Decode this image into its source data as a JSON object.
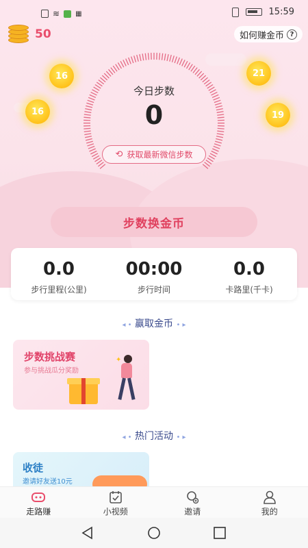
{
  "status_bar": {
    "time": "15:59"
  },
  "header": {
    "coin_count": "50",
    "how_to_earn": "如何赚金币"
  },
  "bubbles": [
    "16",
    "21",
    "16",
    "19"
  ],
  "steps": {
    "title": "今日步数",
    "value": "0",
    "refresh_label": "获取最新微信步数"
  },
  "exchange_button": "步数换金币",
  "stats": [
    {
      "value": "0.0",
      "label": "步行里程(公里)"
    },
    {
      "value": "00:00",
      "label": "步行时间"
    },
    {
      "value": "0.0",
      "label": "卡路里(千卡)"
    }
  ],
  "sections": {
    "earn": "赢取金币",
    "hot": "热门活动"
  },
  "challenge": {
    "title": "步数挑战赛",
    "subtitle": "参与挑战瓜分奖励"
  },
  "recruit": {
    "title": "收徒",
    "subtitle": "邀请好友送10元"
  },
  "nav": [
    {
      "label": "走路赚",
      "icon": "gamepad-icon"
    },
    {
      "label": "小视频",
      "icon": "calendar-video-icon"
    },
    {
      "label": "邀请",
      "icon": "invite-icon"
    },
    {
      "label": "我的",
      "icon": "user-icon"
    }
  ],
  "colors": {
    "accent": "#e94d6b",
    "hero_bg": "#fbe3ea",
    "section_title": "#3a4a8c"
  }
}
